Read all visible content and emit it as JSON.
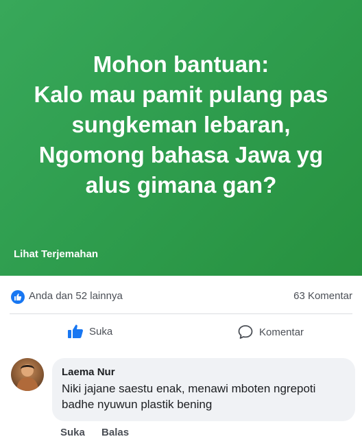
{
  "post": {
    "banner_lines": [
      "Mohon bantuan:",
      "Kalo mau pamit pulang pas",
      "sungkeman lebaran,",
      "Ngomong bahasa Jawa yg",
      "alus gimana gan?"
    ],
    "banner_color": "#2f9e4f",
    "see_translation": "Lihat Terjemahan"
  },
  "reactions": {
    "summary": "Anda dan 52 lainnya",
    "comments_count": "63 Komentar",
    "icon": "like-icon",
    "accent": "#1877f2"
  },
  "actions": {
    "like_label": "Suka",
    "comment_label": "Komentar"
  },
  "comment": {
    "author": "Laema Nur",
    "text": "Niki jajane saestu enak, menawi mboten ngrepoti badhe nyuwun plastik bening",
    "like_label": "Suka",
    "reply_label": "Balas"
  }
}
